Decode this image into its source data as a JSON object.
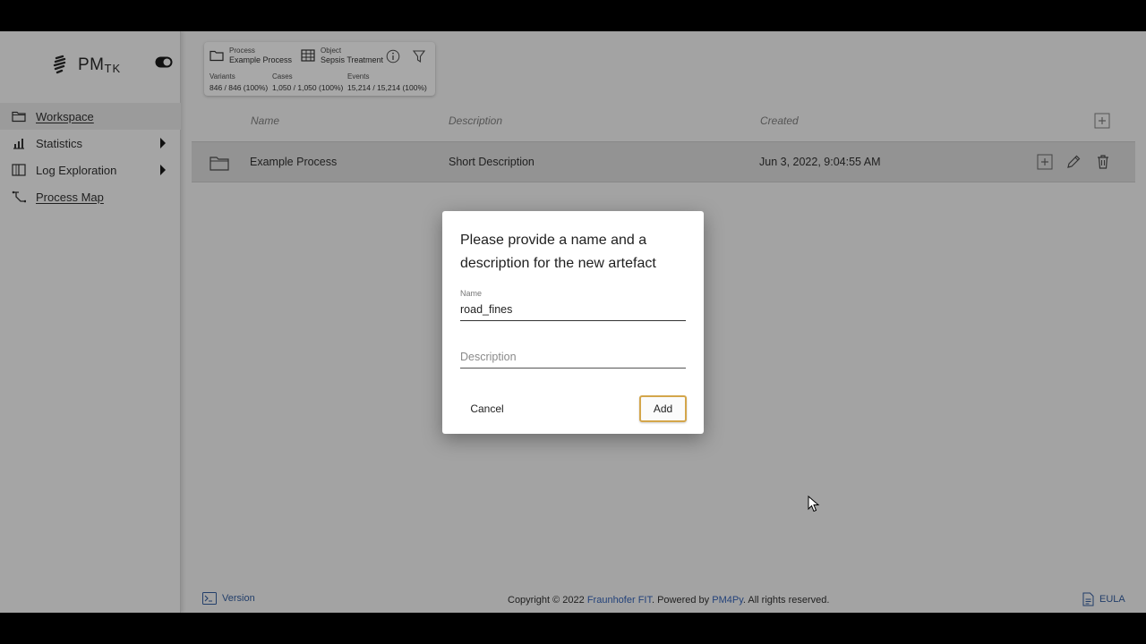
{
  "app": {
    "logo_main": "PM",
    "logo_sub": "TK"
  },
  "sidebar": {
    "items": [
      {
        "label": "Workspace",
        "icon": "folder-icon",
        "active": true
      },
      {
        "label": "Statistics",
        "icon": "bar-chart-icon",
        "expandable": true
      },
      {
        "label": "Log Exploration",
        "icon": "book-icon",
        "expandable": true
      },
      {
        "label": "Process Map",
        "icon": "process-map-icon"
      }
    ]
  },
  "info_panel": {
    "process_label": "Process",
    "process_value": "Example Process",
    "object_label": "Object",
    "object_value": "Sepsis Treatment",
    "variants_label": "Variants",
    "variants_value": "846 / 846 (100%)",
    "cases_label": "Cases",
    "cases_value": "1,050 / 1,050 (100%)",
    "events_label": "Events",
    "events_value": "15,214 / 15,214 (100%)"
  },
  "table": {
    "headers": {
      "name": "Name",
      "description": "Description",
      "created": "Created"
    },
    "rows": [
      {
        "name": "Example Process",
        "description": "Short Description",
        "created": "Jun 3, 2022, 9:04:55 AM"
      }
    ]
  },
  "dialog": {
    "title": "Please provide a name and a description for the new artefact",
    "name_label": "Name",
    "name_value": "road_fines",
    "description_placeholder": "Description",
    "cancel_label": "Cancel",
    "add_label": "Add"
  },
  "footer": {
    "version_label": "Version",
    "copyright_prefix": "Copyright © 2022 ",
    "org": "Fraunhofer FIT",
    "powered_by": ". Powered by ",
    "lib": "PM4Py",
    "suffix": ". All rights reserved.",
    "eula_label": "EULA"
  },
  "colors": {
    "accent_border": "#d4a64b",
    "link": "#23427a",
    "overlay": "#a3a3a3"
  }
}
